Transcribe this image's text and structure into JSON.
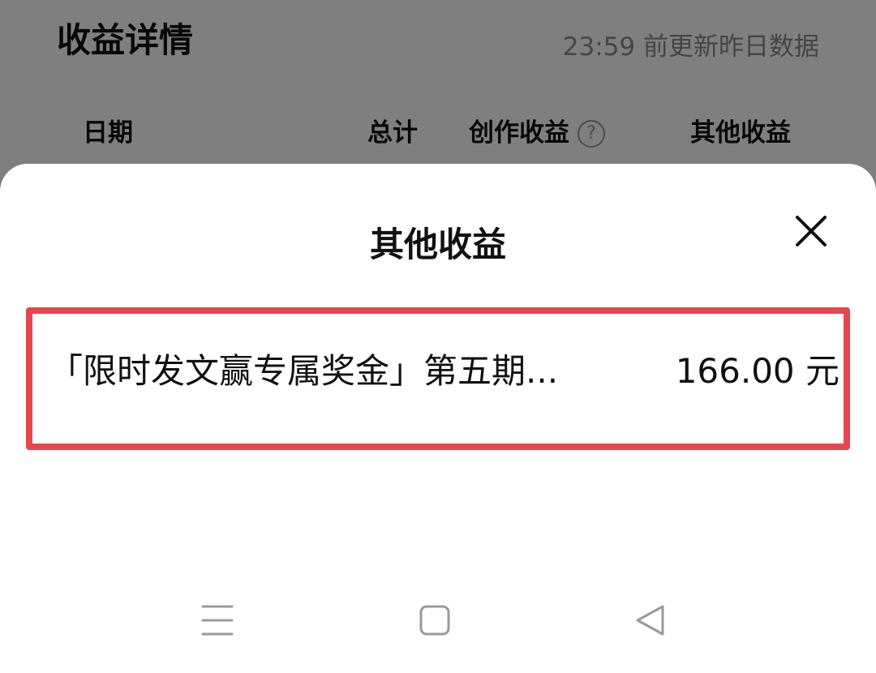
{
  "background_page": {
    "title": "收益详情",
    "update_note": "23:59 前更新昨日数据",
    "columns": {
      "date": "日期",
      "total": "总计",
      "creation_income": "创作收益",
      "other_income": "其他收益"
    },
    "help_icon": "question-circle-icon",
    "help_glyph": "?"
  },
  "sheet": {
    "title": "其他收益",
    "close_icon": "close-icon",
    "items": [
      {
        "name": "「限时发文赢专属奖金」第五期...",
        "amount": "166.00 元"
      }
    ],
    "highlight_color": "#e8464d"
  },
  "nav_bar": {
    "menu_icon": "menu-icon",
    "home_icon": "home-square-icon",
    "back_icon": "back-triangle-icon"
  }
}
